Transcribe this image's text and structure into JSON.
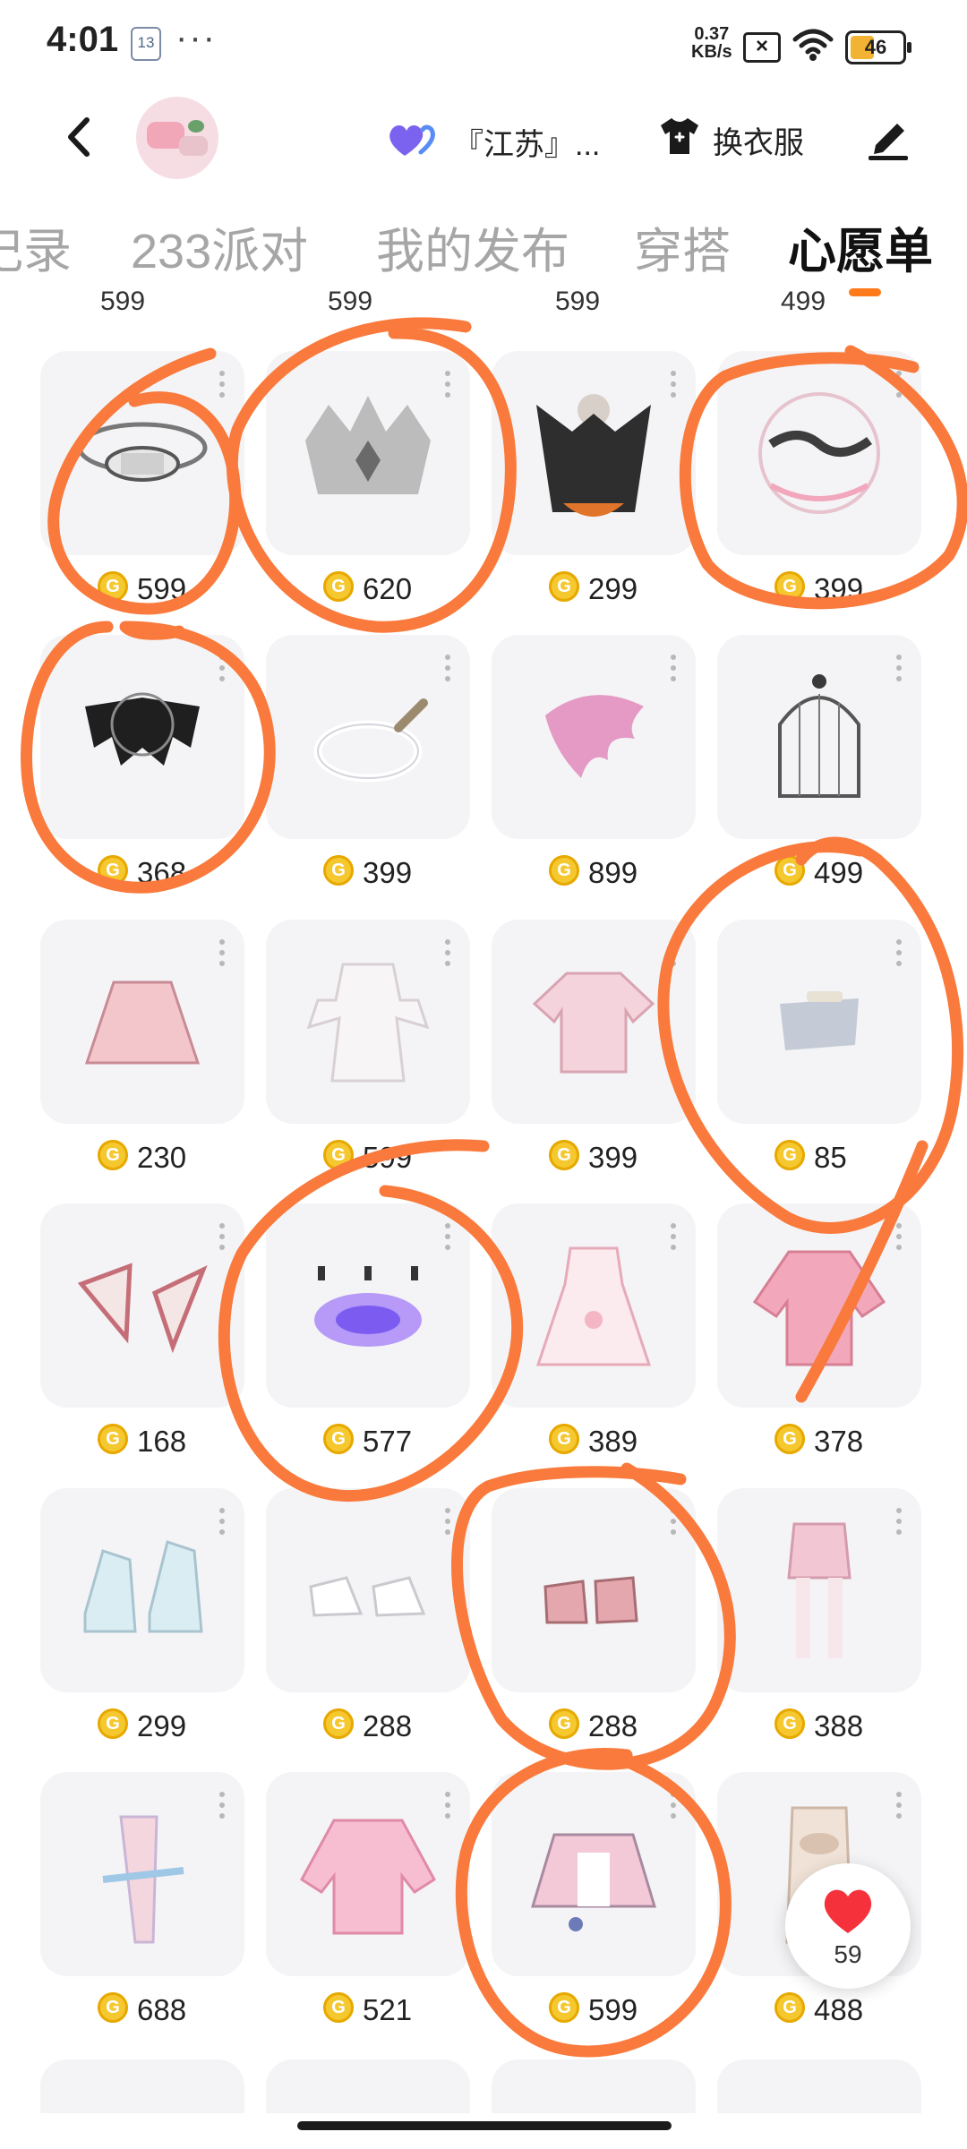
{
  "status_bar": {
    "time": "4:01",
    "calendar_day": "13",
    "more_dots": "···",
    "net_speed_value": "0.37",
    "net_speed_unit": "KB/s",
    "battery": "46"
  },
  "header": {
    "location": "『江苏』...",
    "change_clothes": "换衣服"
  },
  "tabs": [
    {
      "label": "记录"
    },
    {
      "label": "233派对"
    },
    {
      "label": "我的发布"
    },
    {
      "label": "穿搭"
    },
    {
      "label": "心愿单"
    }
  ],
  "active_tab": "心愿单",
  "top_partial_prices": [
    "599",
    "599",
    "599",
    "499"
  ],
  "items": [
    {
      "price": "599",
      "icon": "halo-rings"
    },
    {
      "price": "620",
      "icon": "crystal-crown"
    },
    {
      "price": "299",
      "icon": "reaper-cloak"
    },
    {
      "price": "399",
      "icon": "ink-circle-ornament"
    },
    {
      "price": "368",
      "icon": "bat-wings"
    },
    {
      "price": "399",
      "icon": "pearl-necklace"
    },
    {
      "price": "899",
      "icon": "pink-wing"
    },
    {
      "price": "499",
      "icon": "bird-cage"
    },
    {
      "price": "230",
      "icon": "pink-skirt"
    },
    {
      "price": "599",
      "icon": "white-dress"
    },
    {
      "price": "399",
      "icon": "pink-top"
    },
    {
      "price": "85",
      "icon": "silver-band"
    },
    {
      "price": "168",
      "icon": "fox-ears"
    },
    {
      "price": "577",
      "icon": "magic-circle"
    },
    {
      "price": "389",
      "icon": "lolita-dress"
    },
    {
      "price": "378",
      "icon": "pink-sweater"
    },
    {
      "price": "299",
      "icon": "platform-heels"
    },
    {
      "price": "288",
      "icon": "white-shoes"
    },
    {
      "price": "288",
      "icon": "pink-boots"
    },
    {
      "price": "388",
      "icon": "stockings"
    },
    {
      "price": "688",
      "icon": "ribbon-leg"
    },
    {
      "price": "521",
      "icon": "pink-jacket"
    },
    {
      "price": "599",
      "icon": "maid-outfit"
    },
    {
      "price": "488",
      "icon": "beige-bodysuit"
    }
  ],
  "like_count": "59",
  "colors": {
    "accent": "#ff7a1a",
    "annotation": "#f97a3c",
    "coin": "#f6c830",
    "card_bg": "#f4f4f6",
    "heart": "#f5313b"
  }
}
